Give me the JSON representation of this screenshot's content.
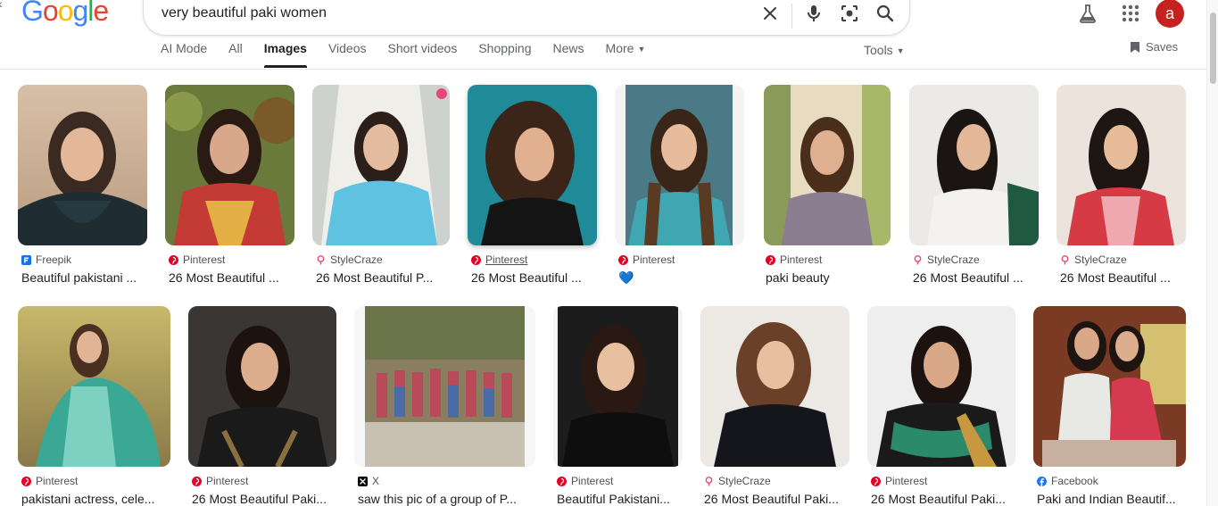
{
  "logo_letters": [
    "G",
    "o",
    "o",
    "g",
    "l",
    "e"
  ],
  "search": {
    "query": "very beautiful paki women"
  },
  "user": {
    "initial": "a"
  },
  "tabs": [
    {
      "label": "AI Mode"
    },
    {
      "label": "All"
    },
    {
      "label": "Images",
      "active": true
    },
    {
      "label": "Videos"
    },
    {
      "label": "Short videos"
    },
    {
      "label": "Shopping"
    },
    {
      "label": "News"
    },
    {
      "label": "More"
    }
  ],
  "tools_label": "Tools",
  "saves_label": "Saves",
  "results_row1": [
    {
      "source": "Freepik",
      "icon": "freepik-icon",
      "title": "Beautiful pakistani ..."
    },
    {
      "source": "Pinterest",
      "icon": "pinterest-icon",
      "title": "26 Most Beautiful ..."
    },
    {
      "source": "StyleCraze",
      "icon": "stylecraze-icon",
      "title": "26 Most Beautiful P..."
    },
    {
      "source": "Pinterest",
      "icon": "pinterest-icon",
      "title": "26 Most Beautiful ..."
    },
    {
      "source": "Pinterest",
      "icon": "pinterest-icon",
      "title": "💙"
    },
    {
      "source": "Pinterest",
      "icon": "pinterest-icon",
      "title": "paki beauty"
    },
    {
      "source": "StyleCraze",
      "icon": "stylecraze-icon",
      "title": "26 Most Beautiful ..."
    },
    {
      "source": "StyleCraze",
      "icon": "stylecraze-icon",
      "title": "26 Most Beautiful ..."
    }
  ],
  "results_row2": [
    {
      "source": "Pinterest",
      "icon": "pinterest-icon",
      "title": "pakistani actress, cele..."
    },
    {
      "source": "Pinterest",
      "icon": "pinterest-icon",
      "title": "26 Most Beautiful Paki..."
    },
    {
      "source": "X",
      "icon": "x-icon",
      "title": "saw this pic of a group of P..."
    },
    {
      "source": "Pinterest",
      "icon": "pinterest-icon",
      "title": "Beautiful Pakistani..."
    },
    {
      "source": "StyleCraze",
      "icon": "stylecraze-icon",
      "title": "26 Most Beautiful Paki..."
    },
    {
      "source": "Pinterest",
      "icon": "pinterest-icon",
      "title": "26 Most Beautiful Paki..."
    },
    {
      "source": "Facebook",
      "icon": "facebook-icon",
      "title": "Paki and Indian Beautif..."
    }
  ],
  "colors": {
    "pinterest": "#e60023",
    "stylecraze": "#e8477d",
    "freepik": "#1273eb",
    "facebook": "#1877f2",
    "avatar": "#c5221f"
  }
}
